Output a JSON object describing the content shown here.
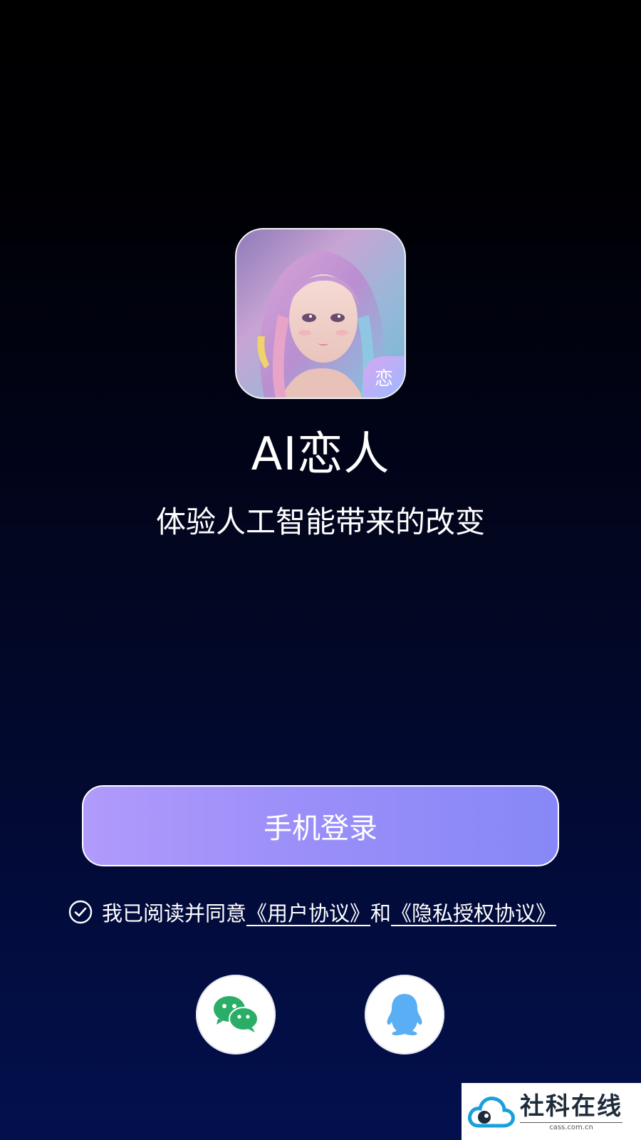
{
  "app": {
    "name": "AI恋人",
    "tagline": "体验人工智能带来的改变",
    "badge_char": "恋"
  },
  "login": {
    "phone_login_label": "手机登录"
  },
  "agreement": {
    "checked": true,
    "prefix": "我已阅读并同意",
    "user_agreement": "《用户协议》",
    "conjunction": "和",
    "privacy_agreement": "《隐私授权协议》"
  },
  "social_login": [
    {
      "icon": "wechat-icon",
      "color": "#2aae67"
    },
    {
      "icon": "qq-icon",
      "color": "#5aaef3"
    }
  ],
  "watermark": {
    "name": "社科在线",
    "url": "cass.com.cn"
  },
  "colors": {
    "button_gradient_start": "#b19afb",
    "button_gradient_end": "#8787f7",
    "background_bottom": "#03104e"
  }
}
